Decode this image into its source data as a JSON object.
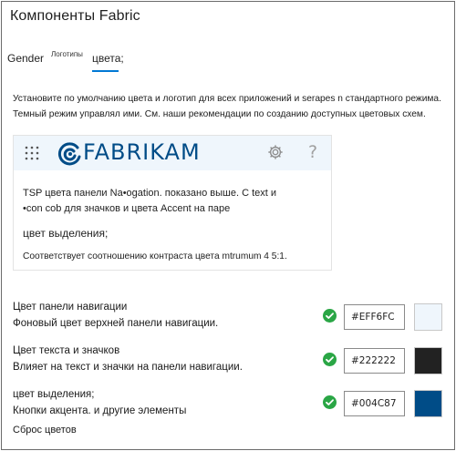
{
  "page": {
    "title": "Компоненты Fabric"
  },
  "tabs": [
    {
      "label": "Gender"
    },
    {
      "label": "Логотипы"
    },
    {
      "label": "цвета;"
    }
  ],
  "description": {
    "line1": "Установите по умолчанию цвета и логотип для всех приложений и serapes n стандартного режима.",
    "line2": "Темный режим управлял ими. См. наши рекомендации по созданию доступных цветовых схем."
  },
  "preview": {
    "logo_text": "FABRIKAM",
    "help_glyph": "?",
    "line1": "TSP цвета панели Na•ogation. показано выше. С text и",
    "line2": "•con cob для значков и цвета Accent на паре",
    "accent_label": "цвет выделения;",
    "contrast_text": "Соответствует соотношению контраста цвета mtrumum 4 5:1.",
    "icons": {
      "waffle": "waffle-icon",
      "logo": "fabrikam-logo-icon",
      "settings": "gear-icon"
    }
  },
  "settings": [
    {
      "title": "Цвет панели навигации",
      "subtitle": "Фоновый цвет верхней панели навигации.",
      "value": "#EFF6FC",
      "color": "#eff6fc"
    },
    {
      "title": "Цвет текста и значков",
      "subtitle": "Влияет на текст и значки на панели навигации.",
      "value": "#222222",
      "color": "#222222"
    },
    {
      "title": "цвет выделения;",
      "subtitle": "Кнопки акцента. и другие элементы",
      "value": "#004C87",
      "color": "#004c87"
    }
  ],
  "reset_label": "Сброс цветов",
  "colors": {
    "accent": "#0078d4",
    "check": "#2aa645",
    "nav_bg": "#eff6fc",
    "brand": "#004c87"
  }
}
